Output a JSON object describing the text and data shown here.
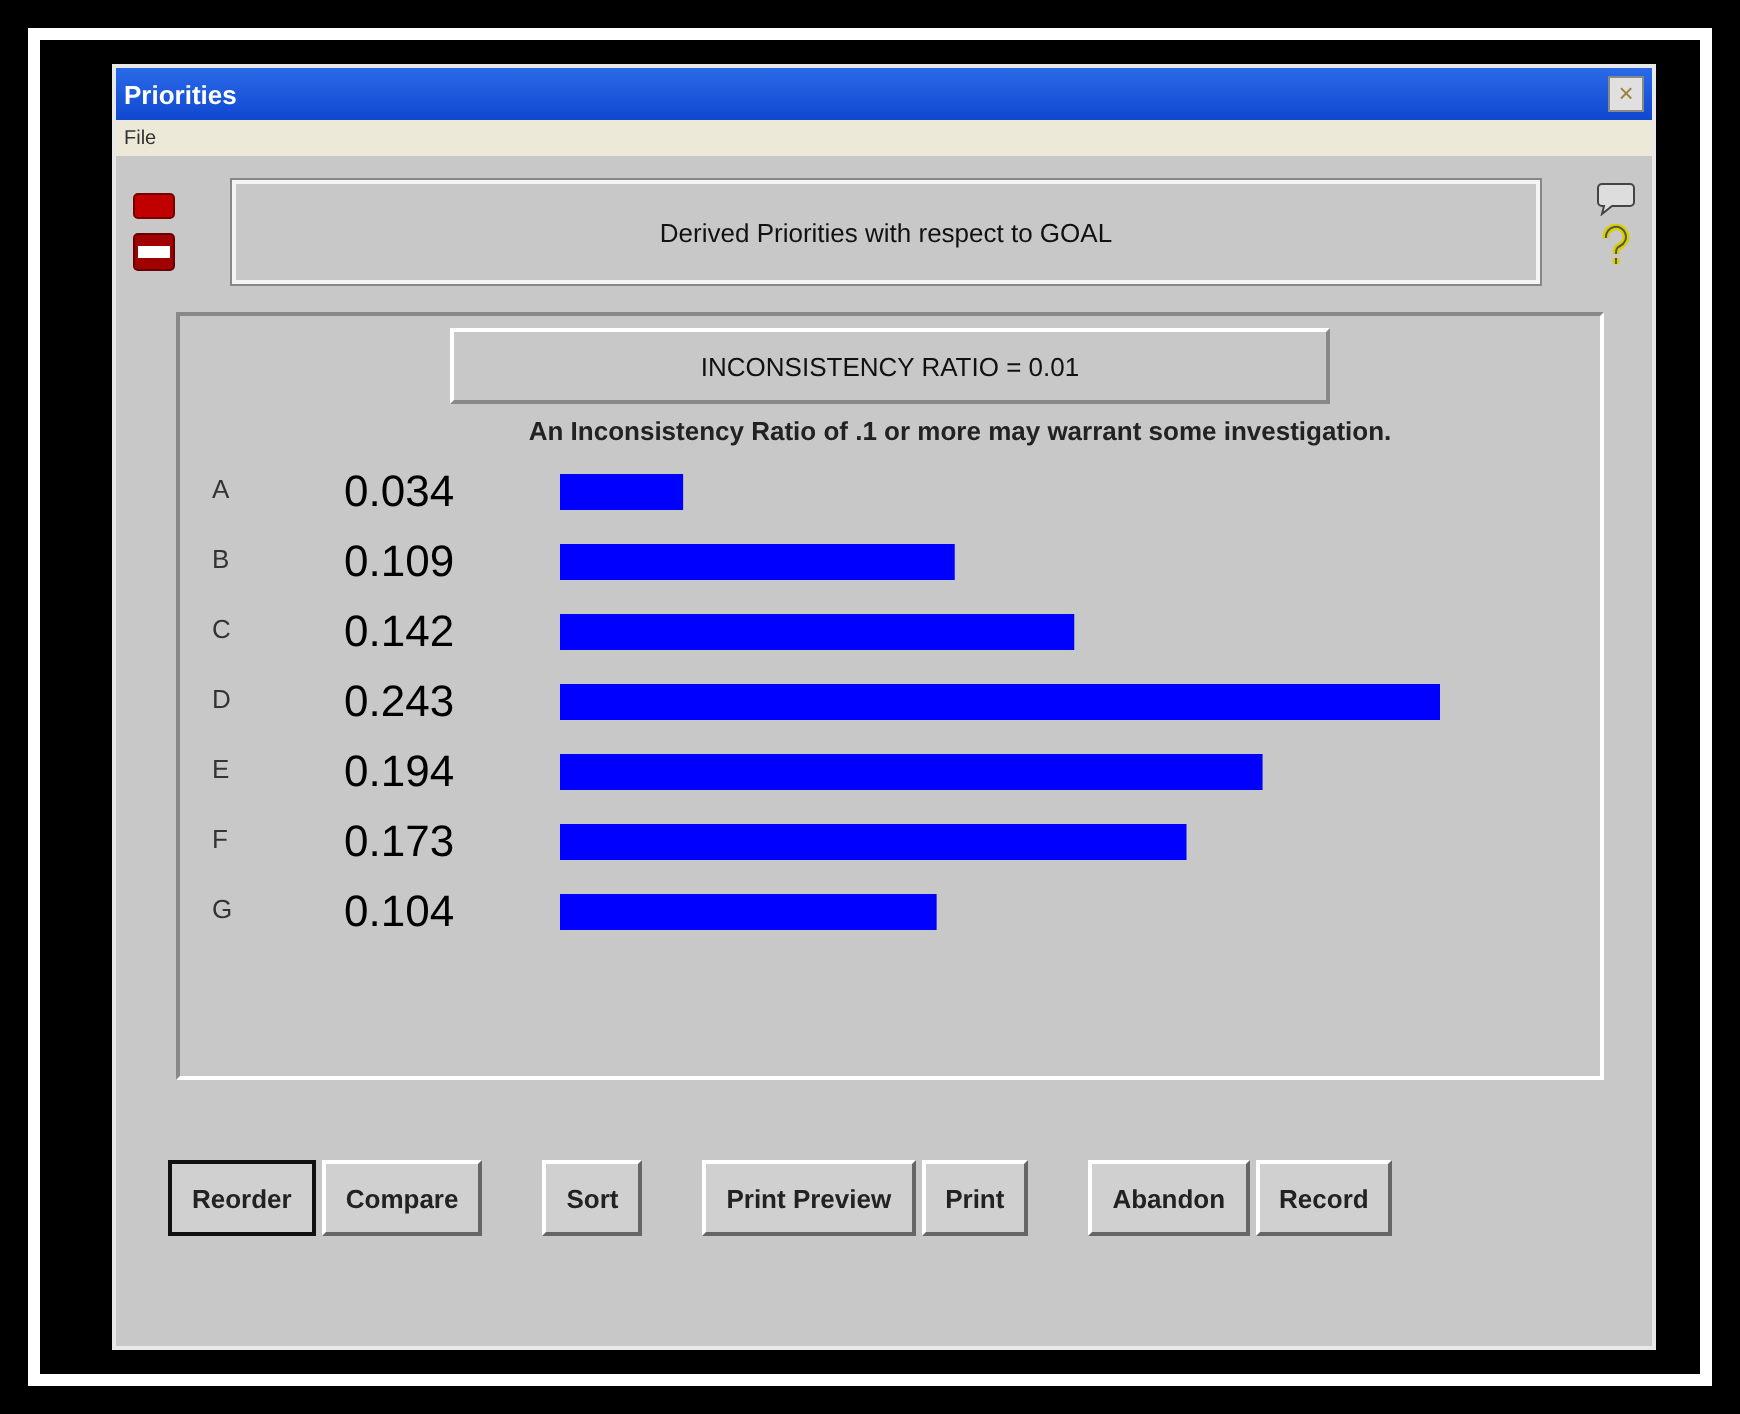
{
  "window": {
    "title": "Priorities",
    "close": "×"
  },
  "menu": [
    "File"
  ],
  "header": "Derived Priorities with respect to GOAL",
  "inconsistency": {
    "label": "INCONSISTENCY RATIO = 0.01",
    "note": "An Inconsistency Ratio of .1 or more may warrant some investigation."
  },
  "chart_data": {
    "type": "bar",
    "orientation": "horizontal",
    "categories": [
      "A",
      "B",
      "C",
      "D",
      "E",
      "F",
      "G"
    ],
    "values": [
      0.034,
      0.109,
      0.142,
      0.243,
      0.194,
      0.173,
      0.104
    ],
    "data_labels": true
  },
  "buttons": [
    {
      "label": "Reorder",
      "selected": true
    },
    {
      "label": "Compare",
      "selected": false
    },
    {
      "label": "Sort",
      "selected": false
    },
    {
      "label": "Print Preview",
      "selected": false
    },
    {
      "label": "Print",
      "selected": false
    },
    {
      "label": "Abandon",
      "selected": false
    },
    {
      "label": "Record",
      "selected": false
    }
  ]
}
